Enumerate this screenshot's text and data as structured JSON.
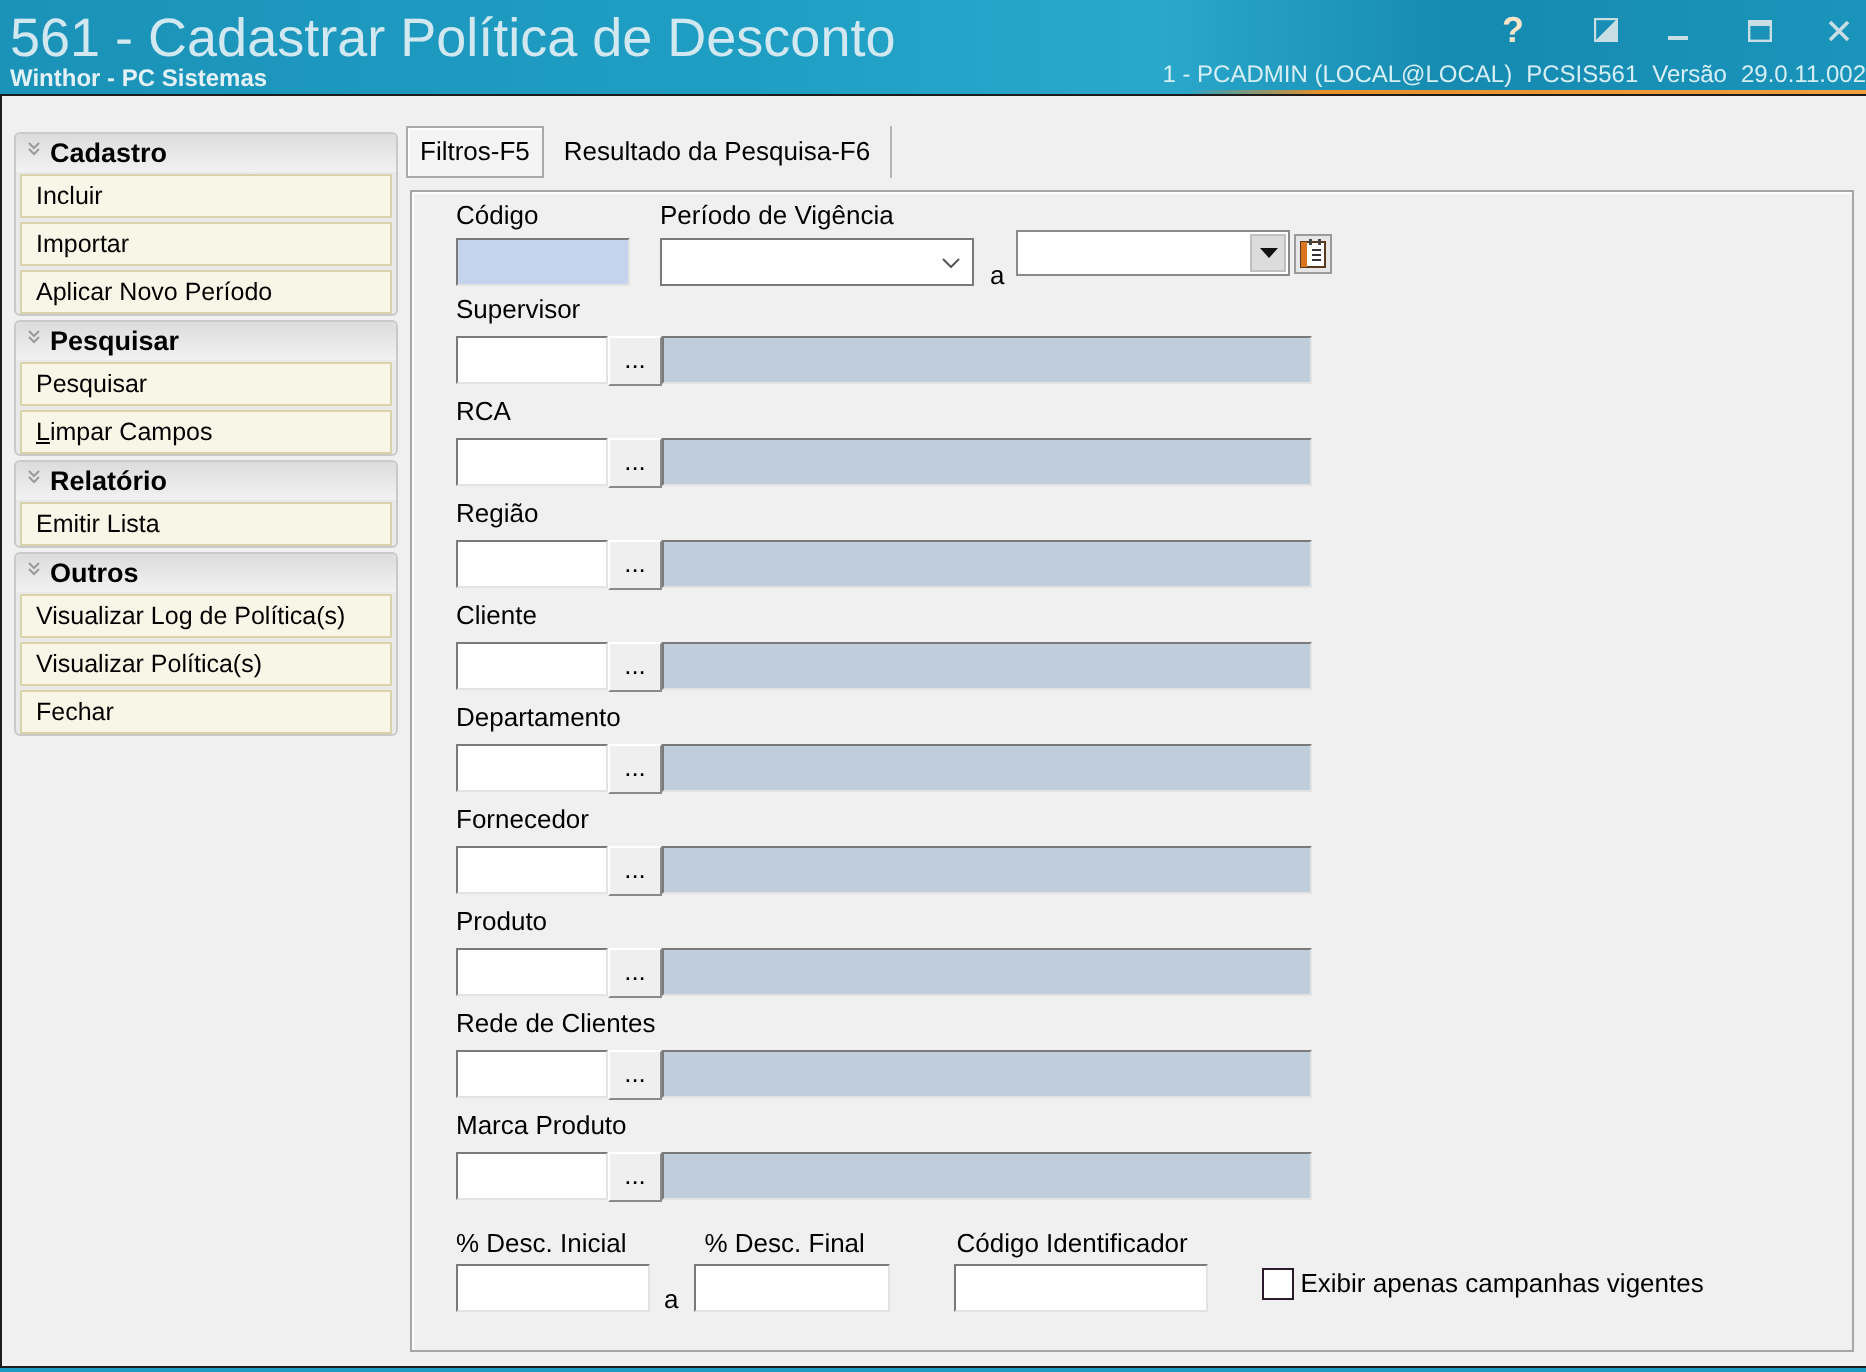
{
  "window": {
    "title": "561 - Cadastrar Política de Desconto",
    "subtitle": "Winthor - PC Sistemas",
    "help": "?",
    "session_info": [
      "1 - PCADMIN (LOCAL@LOCAL)",
      "PCSIS561",
      "Versão",
      "29.0.11.002"
    ]
  },
  "sidebar": {
    "groups": [
      {
        "title": "Cadastro",
        "items": [
          {
            "label": "Incluir",
            "accelerator_underlined": false
          },
          {
            "label": "Importar",
            "accelerator_underlined": false
          },
          {
            "label": "Aplicar Novo Período",
            "accelerator_underlined": false
          }
        ]
      },
      {
        "title": "Pesquisar",
        "items": [
          {
            "label": "Pesquisar",
            "accelerator_underlined": false
          },
          {
            "label": "Limpar Campos",
            "accelerator_underlined": true
          }
        ]
      },
      {
        "title": "Relatório",
        "items": [
          {
            "label": "Emitir Lista",
            "accelerator_underlined": false
          }
        ]
      },
      {
        "title": "Outros",
        "items": [
          {
            "label": "Visualizar Log de Política(s)",
            "accelerator_underlined": false
          },
          {
            "label": "Visualizar Política(s)",
            "accelerator_underlined": false
          },
          {
            "label": "Fechar",
            "accelerator_underlined": false
          }
        ]
      }
    ]
  },
  "tabs": [
    {
      "label": "Filtros-F5",
      "selected": true
    },
    {
      "label": "Resultado da Pesquisa-F6",
      "selected": false
    }
  ],
  "filters": {
    "code": {
      "label": "Código"
    },
    "period": {
      "label": "Período de Vigência",
      "separator": "a"
    },
    "lookups": [
      {
        "label": "Supervisor",
        "button": "..."
      },
      {
        "label": "RCA",
        "button": "..."
      },
      {
        "label": "Região",
        "button": "..."
      },
      {
        "label": "Cliente",
        "button": "..."
      },
      {
        "label": "Departamento",
        "button": "..."
      },
      {
        "label": "Fornecedor",
        "button": "..."
      },
      {
        "label": "Produto",
        "button": "..."
      },
      {
        "label": "Rede de Clientes",
        "button": "..."
      },
      {
        "label": "Marca Produto",
        "button": "..."
      }
    ],
    "discount": {
      "start_label": "% Desc. Inicial",
      "separator": "a",
      "end_label": "% Desc. Final"
    },
    "identifier": {
      "label": "Código Identificador"
    },
    "checkbox": {
      "label": "Exibir apenas campanhas vigentes",
      "checked": false
    }
  }
}
